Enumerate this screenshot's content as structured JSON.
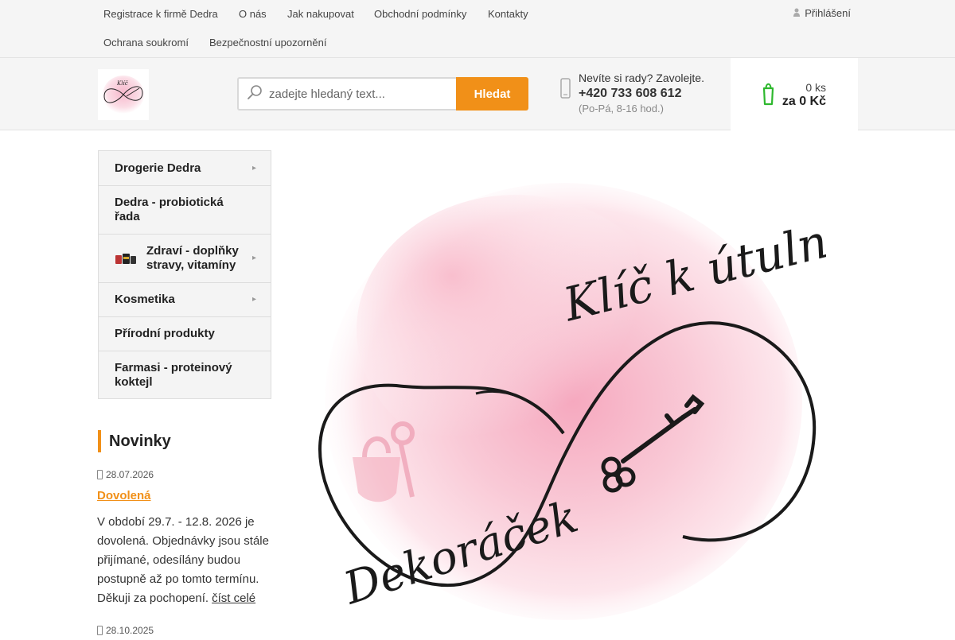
{
  "top_nav": {
    "links": [
      "Registrace k firmě Dedra",
      "O nás",
      "Jak nakupovat",
      "Obchodní podmínky",
      "Kontakty",
      "Ochrana soukromí",
      "Bezpečnostní upozornění"
    ],
    "login_label": "Přihlášení"
  },
  "header": {
    "logo_icon": "shop-logo",
    "search": {
      "placeholder": "zadejte hledaný text...",
      "button_label": "Hledat"
    },
    "contact": {
      "question": "Nevíte si rady? Zavolejte.",
      "phone": "+420 733 608 612",
      "hours": "(Po-Pá, 8-16 hod.)"
    },
    "cart": {
      "count": "0 ks",
      "total": "za 0 Kč"
    }
  },
  "colors": {
    "accent": "#f19018",
    "topbar_bg": "#f5f5f5",
    "cart_icon": "#2eb82e"
  },
  "categories": [
    {
      "label": "Drogerie Dedra",
      "has_submenu": true
    },
    {
      "label": "Dedra - probiotická řada",
      "has_submenu": false
    },
    {
      "label": "Zdraví - doplňky stravy, vitamíny",
      "has_submenu": true,
      "has_thumb": true
    },
    {
      "label": "Kosmetika",
      "has_submenu": true
    },
    {
      "label": "Přírodní produkty",
      "has_submenu": false
    },
    {
      "label": "Farmasi - proteinový koktejl",
      "has_submenu": false
    }
  ],
  "news": {
    "heading": "Novinky",
    "items": [
      {
        "date": "28.07.2026",
        "title": "Dovolená",
        "text": "V období 29.7. - 12.8. 2026 je dovolená. Objednávky jsou stále přijímané, odesílány budou postupně až po tomto termínu. Děkuji za pochopení.",
        "read_more": "číst celé"
      },
      {
        "date": "28.10.2025"
      }
    ]
  },
  "banner": {
    "logo_text_top": "Klíč k útulnému domovu",
    "logo_text_bottom": "Dekoráček"
  }
}
